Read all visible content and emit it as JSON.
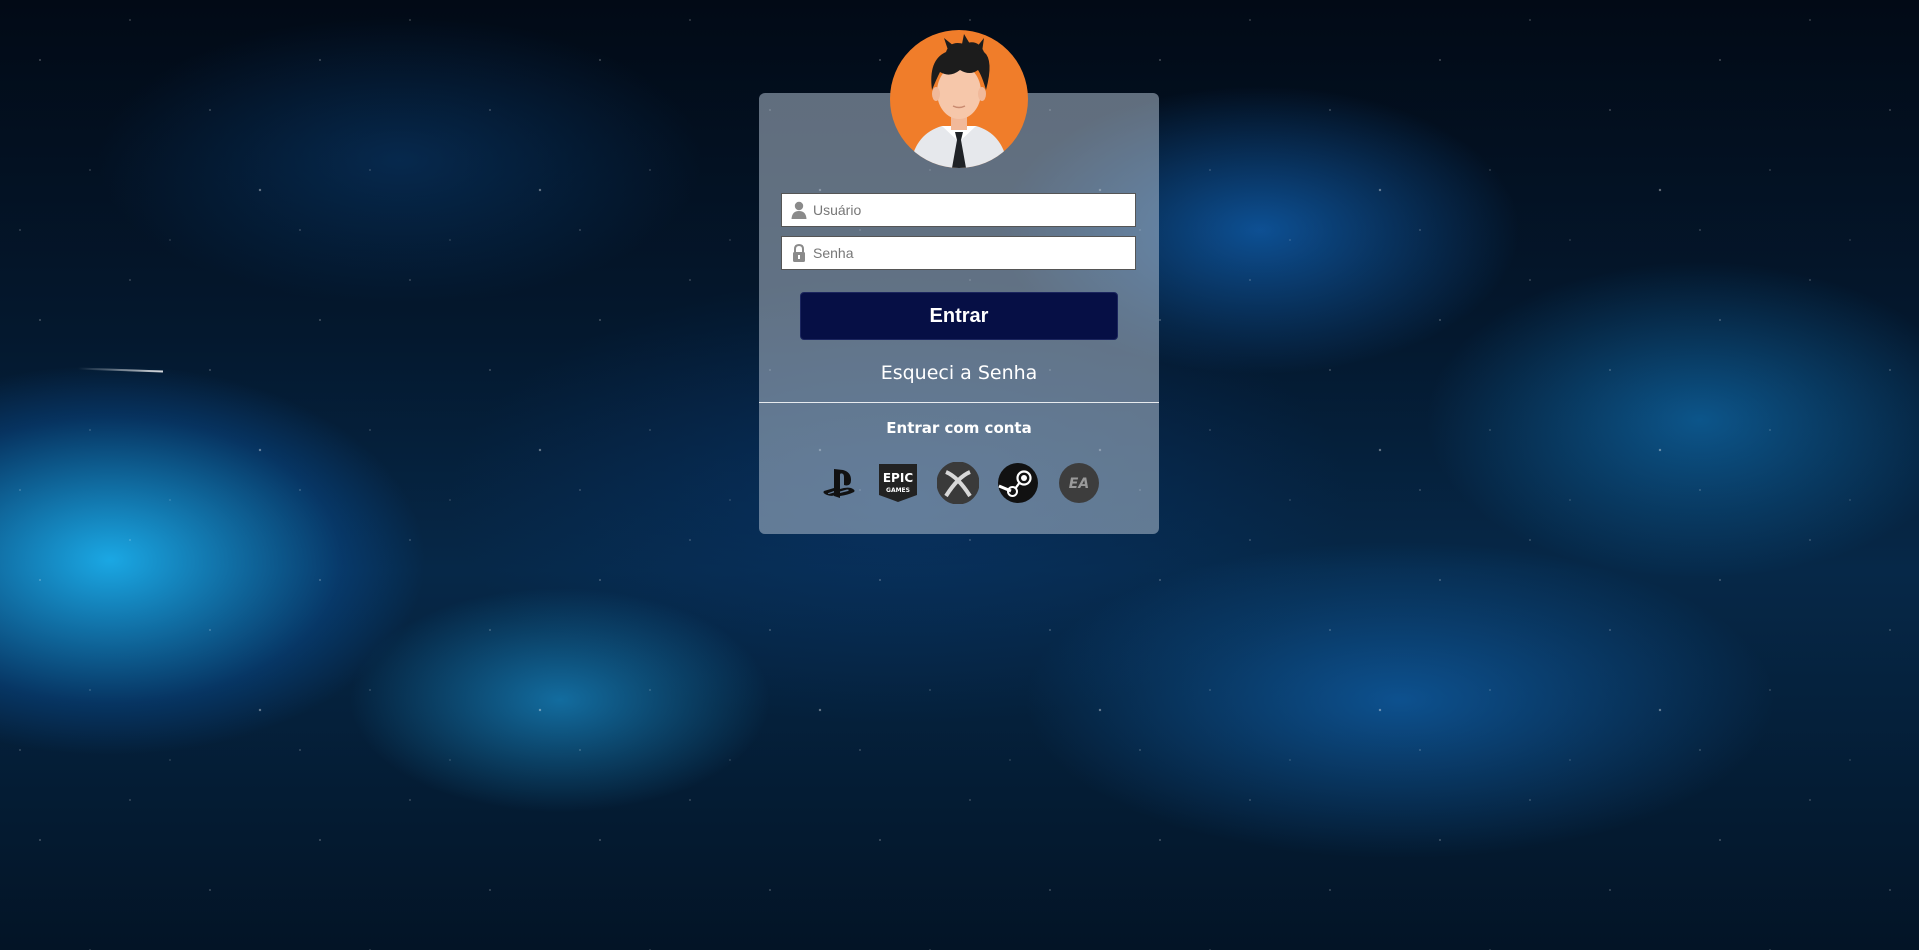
{
  "login": {
    "username_placeholder": "Usuário",
    "password_placeholder": "Senha",
    "submit_label": "Entrar",
    "forgot_label": "Esqueci a Senha",
    "alt_title": "Entrar com conta"
  },
  "social": {
    "epic_line1": "EPIC",
    "epic_line2": "GAMES",
    "ea_label": "EA",
    "icons": [
      "playstation-icon",
      "epic-games-icon",
      "xbox-icon",
      "steam-icon",
      "ea-icon"
    ]
  },
  "colors": {
    "avatar_bg": "#f07d2a",
    "button_bg": "#060f45",
    "card_bg": "rgba(175,190,205,0.55)"
  }
}
